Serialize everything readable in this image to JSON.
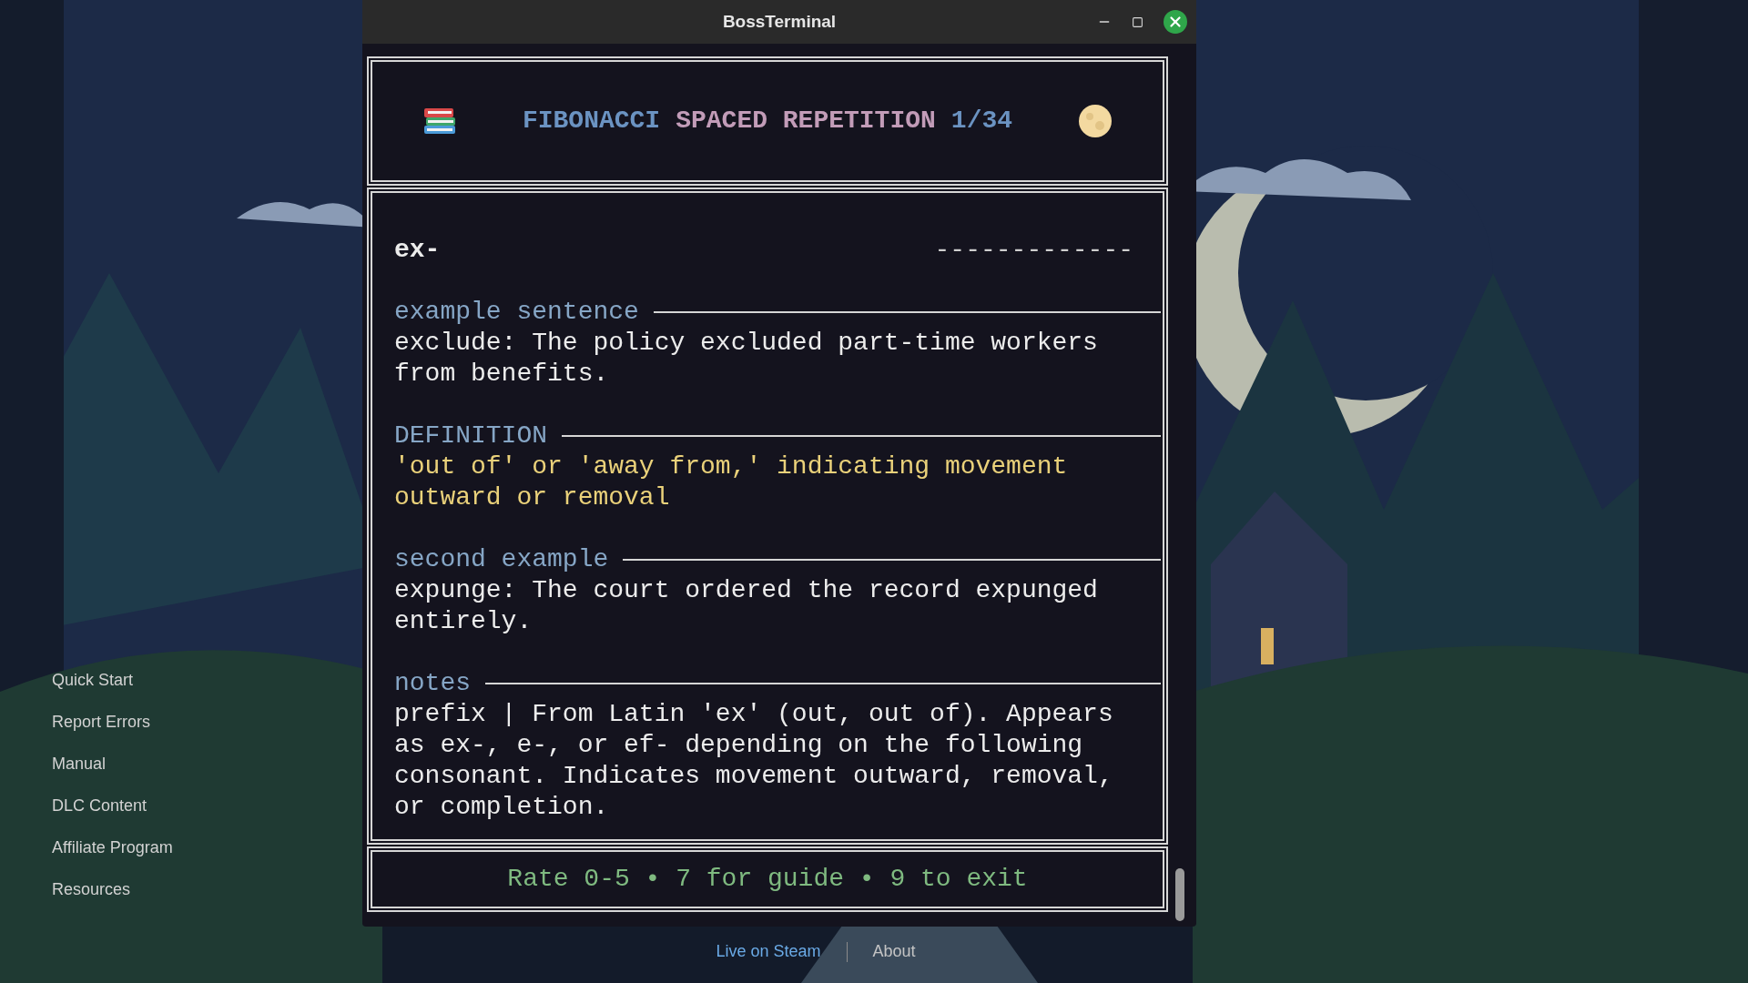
{
  "sidebar": {
    "items": [
      {
        "label": "Quick Start"
      },
      {
        "label": "Report Errors"
      },
      {
        "label": "Manual"
      },
      {
        "label": "DLC Content"
      },
      {
        "label": "Affiliate Program"
      },
      {
        "label": "Resources"
      }
    ]
  },
  "window": {
    "title": "BossTerminal"
  },
  "header": {
    "title_parts": [
      {
        "text": "FIBONACCI",
        "color": "#6b93c2"
      },
      {
        "text": "SPACED REPETITION",
        "color": "#c29cb8"
      },
      {
        "text": "1/34",
        "color": "#6b93c2"
      }
    ]
  },
  "card": {
    "term": "ex-",
    "mask": "-------------",
    "sections": [
      {
        "label": "example sentence",
        "text": "exclude: The policy excluded part-time workers from benefits.",
        "color": "#ececec"
      },
      {
        "label": "DEFINITION",
        "text": "'out of' or 'away from,' indicating movement outward or removal",
        "color": "#ead17a"
      },
      {
        "label": "second example",
        "text": "expunge: The court ordered the record expunged entirely.",
        "color": "#ececec"
      },
      {
        "label": "notes",
        "text": "prefix | From Latin 'ex' (out, out of). Appears as ex-, e-, or ef- depending on the following consonant. Indicates movement outward, removal, or completion.",
        "color": "#ececec"
      }
    ]
  },
  "prompt": "Rate 0-5 • 7 for guide • 9 to exit",
  "footer_links": [
    {
      "label": "Live on Steam",
      "color": "#6aaae6"
    },
    {
      "label": "About",
      "color": "#c4c4c4"
    }
  ]
}
